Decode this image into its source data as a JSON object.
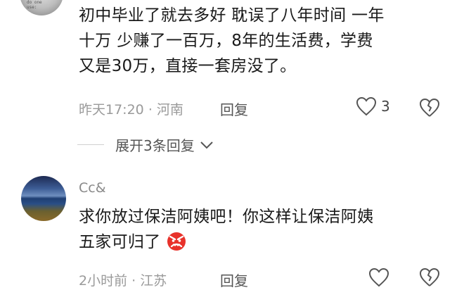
{
  "comment1": {
    "lines": [
      "初中毕业了就去多好 耽误了八年时间 一年",
      "十万  少赚了一百万，8年的生活费，学费",
      "又是30万，直接一套房没了。"
    ],
    "avatar_caption": "do one\nuse:",
    "time": "昨天17:20",
    "location": "河南",
    "reply_label": "回复",
    "like_count": "3",
    "expand_label": "展开3条回复"
  },
  "comment2": {
    "username": "Cc&",
    "lines": [
      "求你放过保洁阿姨吧！你这样让保洁阿姨",
      "五家可归了"
    ],
    "emoji": "angry-face-emoji",
    "time": "2小时前",
    "location": "江苏",
    "reply_label": "回复"
  },
  "colors": {
    "text": "#1a1a1a",
    "meta": "#9a9a9a",
    "icon": "#555555"
  }
}
